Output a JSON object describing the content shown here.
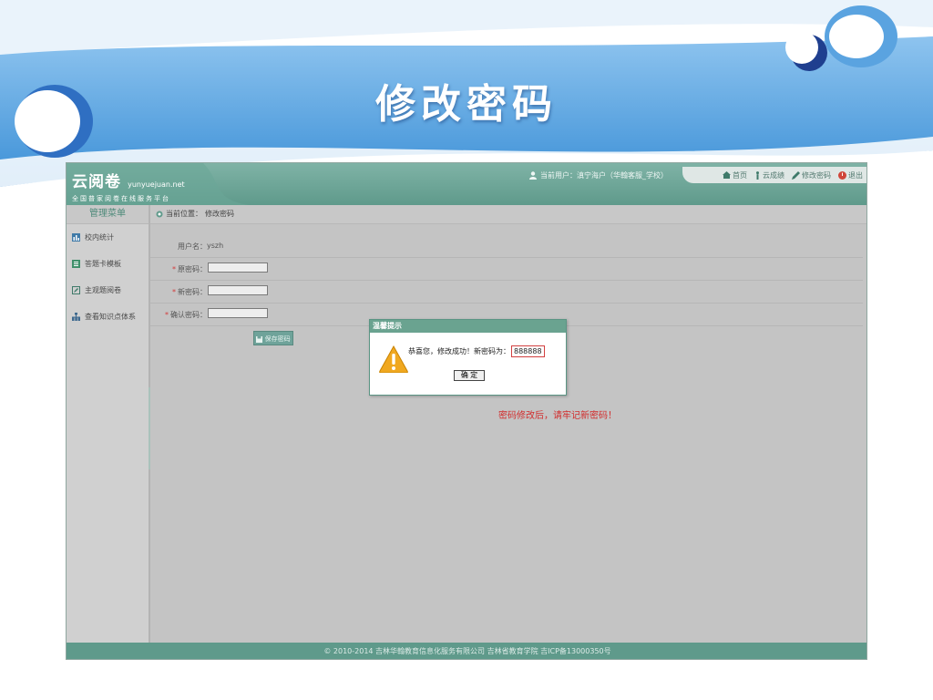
{
  "slide": {
    "title": "修改密码"
  },
  "app": {
    "logo": {
      "main": "云阅卷",
      "domain": "yunyuejuan.net",
      "subtitle": "全国普家阅卷在线服务平台"
    },
    "current_user": "当前用户：滇宁海户（华翰客服_学校）",
    "top_nav": [
      {
        "label": "首页",
        "icon": "home-icon"
      },
      {
        "label": "云成绩",
        "icon": "person-icon"
      },
      {
        "label": "修改密码",
        "icon": "pen-icon"
      },
      {
        "label": "退出",
        "icon": "power-icon"
      }
    ],
    "sidebar": {
      "heading": "管理菜单",
      "items": [
        {
          "label": "校内统计",
          "icon": "chart-icon"
        },
        {
          "label": "答题卡模板",
          "icon": "card-icon"
        },
        {
          "label": "主观题阅卷",
          "icon": "pen-icon"
        },
        {
          "label": "查看知识点体系",
          "icon": "tree-icon"
        }
      ]
    },
    "breadcrumb": {
      "prefix": "当前位置：",
      "page": "修改密码"
    },
    "form": {
      "username_label": "用户名：",
      "username_value": "yszh",
      "old_password_label": "原密码：",
      "new_password_label": "新密码：",
      "confirm_password_label": "确认密码：",
      "required_mark": "*",
      "save_button": "保存密码"
    },
    "dialog": {
      "title": "温馨提示",
      "message_prefix": "恭喜您，修改成功！新密码为：",
      "new_password": "888888",
      "ok_button": "确 定"
    },
    "reminder": "密码修改后，请牢记新密码！",
    "footer": "© 2010-2014 吉林华翰教育信息化服务有限公司  吉林省教育学院  吉ICP备13000350号"
  },
  "colors": {
    "accent": "#5f9a8b",
    "slide_blue": "#5aa3e0",
    "warning": "#d22d2d"
  }
}
